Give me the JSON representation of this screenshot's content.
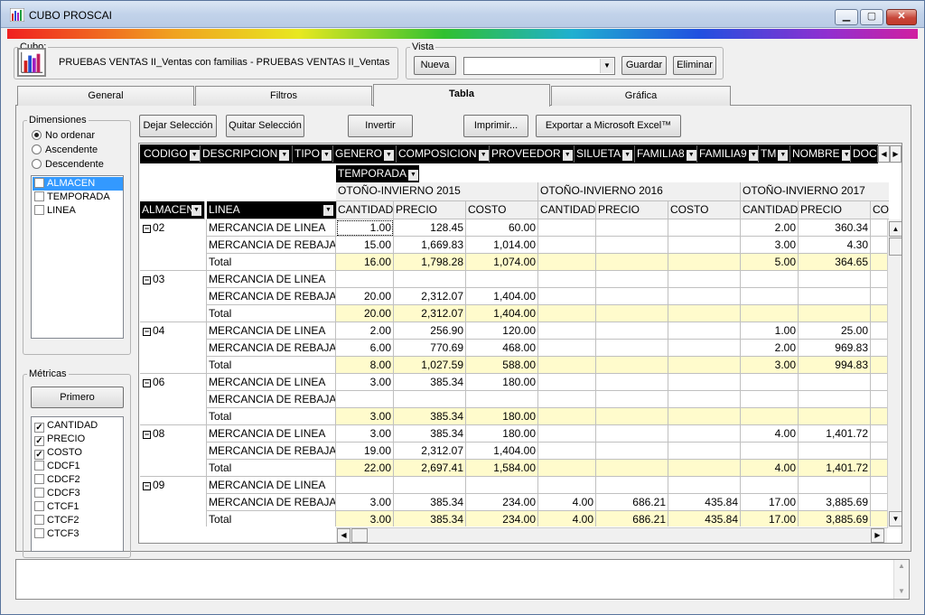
{
  "window": {
    "title": "CUBO PROSCAI"
  },
  "cubo": {
    "legend": "Cubo:",
    "name": "PRUEBAS VENTAS II_Ventas con familias - PRUEBAS VENTAS II_Ventas"
  },
  "vista": {
    "legend": "Vista",
    "nueva": "Nueva",
    "value": "",
    "guardar": "Guardar",
    "eliminar": "Eliminar"
  },
  "tabs": [
    "General",
    "Filtros",
    "Tabla",
    "Gráfica"
  ],
  "dimensiones": {
    "legend": "Dimensiones",
    "sort": [
      "No ordenar",
      "Ascendente",
      "Descendente"
    ],
    "items": [
      "ALMACEN",
      "TEMPORADA",
      "LINEA"
    ]
  },
  "metricas": {
    "legend": "Métricas",
    "primero": "Primero",
    "items": [
      {
        "label": "CANTIDAD",
        "checked": true
      },
      {
        "label": "PRECIO",
        "checked": true
      },
      {
        "label": "COSTO",
        "checked": true
      },
      {
        "label": "CDCF1",
        "checked": false
      },
      {
        "label": "CDCF2",
        "checked": false
      },
      {
        "label": "CDCF3",
        "checked": false
      },
      {
        "label": "CTCF1",
        "checked": false
      },
      {
        "label": "CTCF2",
        "checked": false
      },
      {
        "label": "CTCF3",
        "checked": false
      }
    ]
  },
  "toolbar": {
    "dejar": "Dejar Selección",
    "quitar": "Quitar Selección",
    "invertir": "Invertir",
    "imprimir": "Imprimir...",
    "exportar": "Exportar a Microsoft Excel™"
  },
  "pivot": {
    "fields": [
      "CODIGO",
      "DESCRIPCION",
      "TIPO",
      "GENERO",
      "COMPOSICION",
      "PROVEEDOR",
      "SILUETA",
      "FAMILIA8",
      "FAMILIA9",
      "TM",
      "NOMBRE",
      "DOC"
    ],
    "col_field": "TEMPORADA",
    "row_fields": [
      "ALMACEN",
      "LINEA"
    ],
    "seasons": [
      "OTOÑO-INVIERNO 2015",
      "OTOÑO-INVIERNO 2016",
      "OTOÑO-INVIERNO 2017"
    ],
    "metrics": [
      "CANTIDAD",
      "PRECIO",
      "COSTO",
      "CANTIDAD",
      "PRECIO",
      "COSTO",
      "CANTIDAD",
      "PRECIO",
      "CO"
    ],
    "groups": [
      {
        "almacen": "02",
        "rows": [
          {
            "linea": "MERCANCIA DE LINEA",
            "v": [
              "1.00",
              "128.45",
              "60.00",
              "",
              "",
              "",
              "2.00",
              "360.34",
              ""
            ]
          },
          {
            "linea": "MERCANCIA DE REBAJA",
            "v": [
              "15.00",
              "1,669.83",
              "1,014.00",
              "",
              "",
              "",
              "3.00",
              "4.30",
              ""
            ]
          },
          {
            "linea": "Total",
            "v": [
              "16.00",
              "1,798.28",
              "1,074.00",
              "",
              "",
              "",
              "5.00",
              "364.65",
              ""
            ]
          }
        ]
      },
      {
        "almacen": "03",
        "rows": [
          {
            "linea": "MERCANCIA DE LINEA",
            "v": [
              "",
              "",
              "",
              "",
              "",
              "",
              "",
              "",
              ""
            ]
          },
          {
            "linea": "MERCANCIA DE REBAJA",
            "v": [
              "20.00",
              "2,312.07",
              "1,404.00",
              "",
              "",
              "",
              "",
              "",
              ""
            ]
          },
          {
            "linea": "Total",
            "v": [
              "20.00",
              "2,312.07",
              "1,404.00",
              "",
              "",
              "",
              "",
              "",
              ""
            ]
          }
        ]
      },
      {
        "almacen": "04",
        "rows": [
          {
            "linea": "MERCANCIA DE LINEA",
            "v": [
              "2.00",
              "256.90",
              "120.00",
              "",
              "",
              "",
              "1.00",
              "25.00",
              ""
            ]
          },
          {
            "linea": "MERCANCIA DE REBAJA",
            "v": [
              "6.00",
              "770.69",
              "468.00",
              "",
              "",
              "",
              "2.00",
              "969.83",
              ""
            ]
          },
          {
            "linea": "Total",
            "v": [
              "8.00",
              "1,027.59",
              "588.00",
              "",
              "",
              "",
              "3.00",
              "994.83",
              ""
            ]
          }
        ]
      },
      {
        "almacen": "06",
        "rows": [
          {
            "linea": "MERCANCIA DE LINEA",
            "v": [
              "3.00",
              "385.34",
              "180.00",
              "",
              "",
              "",
              "",
              "",
              ""
            ]
          },
          {
            "linea": "MERCANCIA DE REBAJA",
            "v": [
              "",
              "",
              "",
              "",
              "",
              "",
              "",
              "",
              ""
            ]
          },
          {
            "linea": "Total",
            "v": [
              "3.00",
              "385.34",
              "180.00",
              "",
              "",
              "",
              "",
              "",
              ""
            ]
          }
        ]
      },
      {
        "almacen": "08",
        "rows": [
          {
            "linea": "MERCANCIA DE LINEA",
            "v": [
              "3.00",
              "385.34",
              "180.00",
              "",
              "",
              "",
              "4.00",
              "1,401.72",
              ""
            ]
          },
          {
            "linea": "MERCANCIA DE REBAJA",
            "v": [
              "19.00",
              "2,312.07",
              "1,404.00",
              "",
              "",
              "",
              "",
              "",
              ""
            ]
          },
          {
            "linea": "Total",
            "v": [
              "22.00",
              "2,697.41",
              "1,584.00",
              "",
              "",
              "",
              "4.00",
              "1,401.72",
              ""
            ]
          }
        ]
      },
      {
        "almacen": "09",
        "rows": [
          {
            "linea": "MERCANCIA DE LINEA",
            "v": [
              "",
              "",
              "",
              "",
              "",
              "",
              "",
              "",
              ""
            ]
          },
          {
            "linea": "MERCANCIA DE REBAJA",
            "v": [
              "3.00",
              "385.34",
              "234.00",
              "4.00",
              "686.21",
              "435.84",
              "17.00",
              "3,885.69",
              ""
            ]
          },
          {
            "linea": "Total",
            "v": [
              "3.00",
              "385.34",
              "234.00",
              "4.00",
              "686.21",
              "435.84",
              "17.00",
              "3,885.69",
              ""
            ]
          }
        ]
      }
    ]
  }
}
